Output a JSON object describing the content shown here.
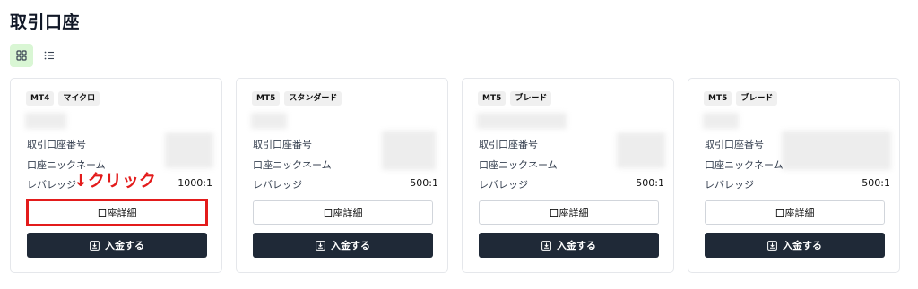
{
  "page": {
    "title": "取引口座"
  },
  "labels": {
    "account_number": "取引口座番号",
    "nickname": "口座ニックネーム",
    "leverage": "レバレッジ"
  },
  "buttons": {
    "detail": "口座詳細",
    "deposit": "入金する"
  },
  "annotation": {
    "arrow": "↓",
    "text": "クリック",
    "color": "#e31b1b"
  },
  "cards": [
    {
      "platform": "MT4",
      "type": "マイクロ",
      "leverage": "1000:1"
    },
    {
      "platform": "MT5",
      "type": "スタンダード",
      "leverage": "500:1"
    },
    {
      "platform": "MT5",
      "type": "ブレード",
      "leverage": "500:1"
    },
    {
      "platform": "MT5",
      "type": "ブレード",
      "leverage": "500:1"
    }
  ],
  "colors": {
    "accent_toggle": "#d9f6d4",
    "deposit_button": "#1f2937"
  }
}
